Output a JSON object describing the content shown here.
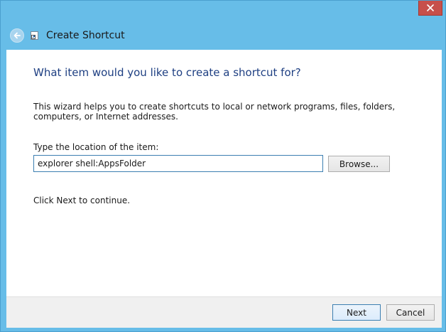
{
  "window": {
    "close_icon": "close-icon",
    "close_color": "#c7504b",
    "frame_color": "#67bde8"
  },
  "header": {
    "back_icon": "back-arrow-icon",
    "shortcut_icon": "shortcut-icon",
    "title": "Create Shortcut"
  },
  "main": {
    "heading": "What item would you like to create a shortcut for?",
    "description": "This wizard helps you to create shortcuts to local or network programs, files, folders, computers, or Internet addresses.",
    "location_label": "Type the location of the item:",
    "location_value": "explorer shell:AppsFolder",
    "browse_label": "Browse...",
    "continue_text": "Click Next to continue."
  },
  "footer": {
    "next_label": "Next",
    "cancel_label": "Cancel"
  }
}
